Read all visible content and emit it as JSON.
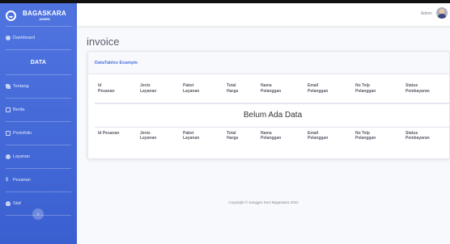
{
  "brand": {
    "name": "BAGASKARA",
    "sub": "ADMIN"
  },
  "sidebar": {
    "items": [
      {
        "label": "Dashboard",
        "icon": "dashboard-icon"
      },
      {
        "label": "DATA"
      },
      {
        "label": "Tentang",
        "icon": "leaf-icon"
      },
      {
        "label": "Berita",
        "icon": "news-icon"
      },
      {
        "label": "Portofolio",
        "icon": "folder-icon"
      },
      {
        "label": "Layanan",
        "icon": "service-icon"
      },
      {
        "label": "Pesanan",
        "icon": "dollar-icon"
      },
      {
        "label": "Staf",
        "icon": "user-icon"
      }
    ],
    "toggle_icon": "‹"
  },
  "topbar": {
    "user_name": "Admin"
  },
  "page": {
    "title": "invoice"
  },
  "card": {
    "title": "DataTables Example"
  },
  "table": {
    "headers": [
      "Id Pesanan",
      "Jenis Layanan",
      "Paket Layanan",
      "Total Harga",
      "Nama Pelanggan",
      "Email Pelanggan",
      "No Telp Pelanggan",
      "Status Pembayaran"
    ],
    "header_lines": [
      [
        "Id",
        "Pesanan"
      ],
      [
        "Jenis",
        "Layanan"
      ],
      [
        "Paket",
        "Layanan"
      ],
      [
        "Total",
        "Harga"
      ],
      [
        "Nama",
        "Pelanggan"
      ],
      [
        "Email",
        "Pelanggan"
      ],
      [
        "No Telp",
        "Pelanggan"
      ],
      [
        "Status",
        "Pembayaran"
      ]
    ],
    "footer_lines": [
      [
        "Id Pesanan"
      ],
      [
        "Jenis",
        "Layanan"
      ],
      [
        "Paket",
        "Layanan"
      ],
      [
        "Total",
        "Harga"
      ],
      [
        "Nama",
        "Pelanggan"
      ],
      [
        "Email",
        "Pelanggan"
      ],
      [
        "No Telp",
        "Pelanggan"
      ],
      [
        "Status",
        "Pembayaran"
      ]
    ],
    "empty_message": "Belum Ada Data"
  },
  "footer": {
    "text": "Copyright © Sanggar Seni Bagaskara 2022"
  },
  "colors": {
    "primary": "#4e73df",
    "text": "#5a5c69",
    "muted": "#858796"
  }
}
